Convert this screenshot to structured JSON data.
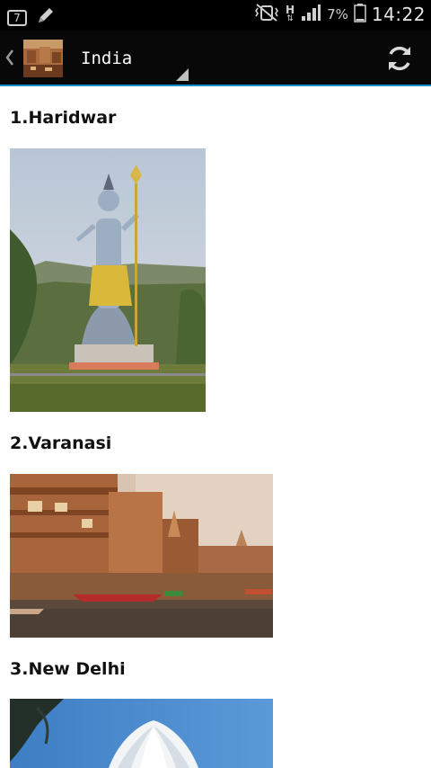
{
  "status_bar": {
    "notification_count": "7",
    "battery_percent": "7%",
    "time": "14:22",
    "network_type": "H"
  },
  "action_bar": {
    "title": "India"
  },
  "places": [
    {
      "title": "1.Haridwar"
    },
    {
      "title": "2.Varanasi"
    },
    {
      "title": "3.New Delhi"
    }
  ]
}
